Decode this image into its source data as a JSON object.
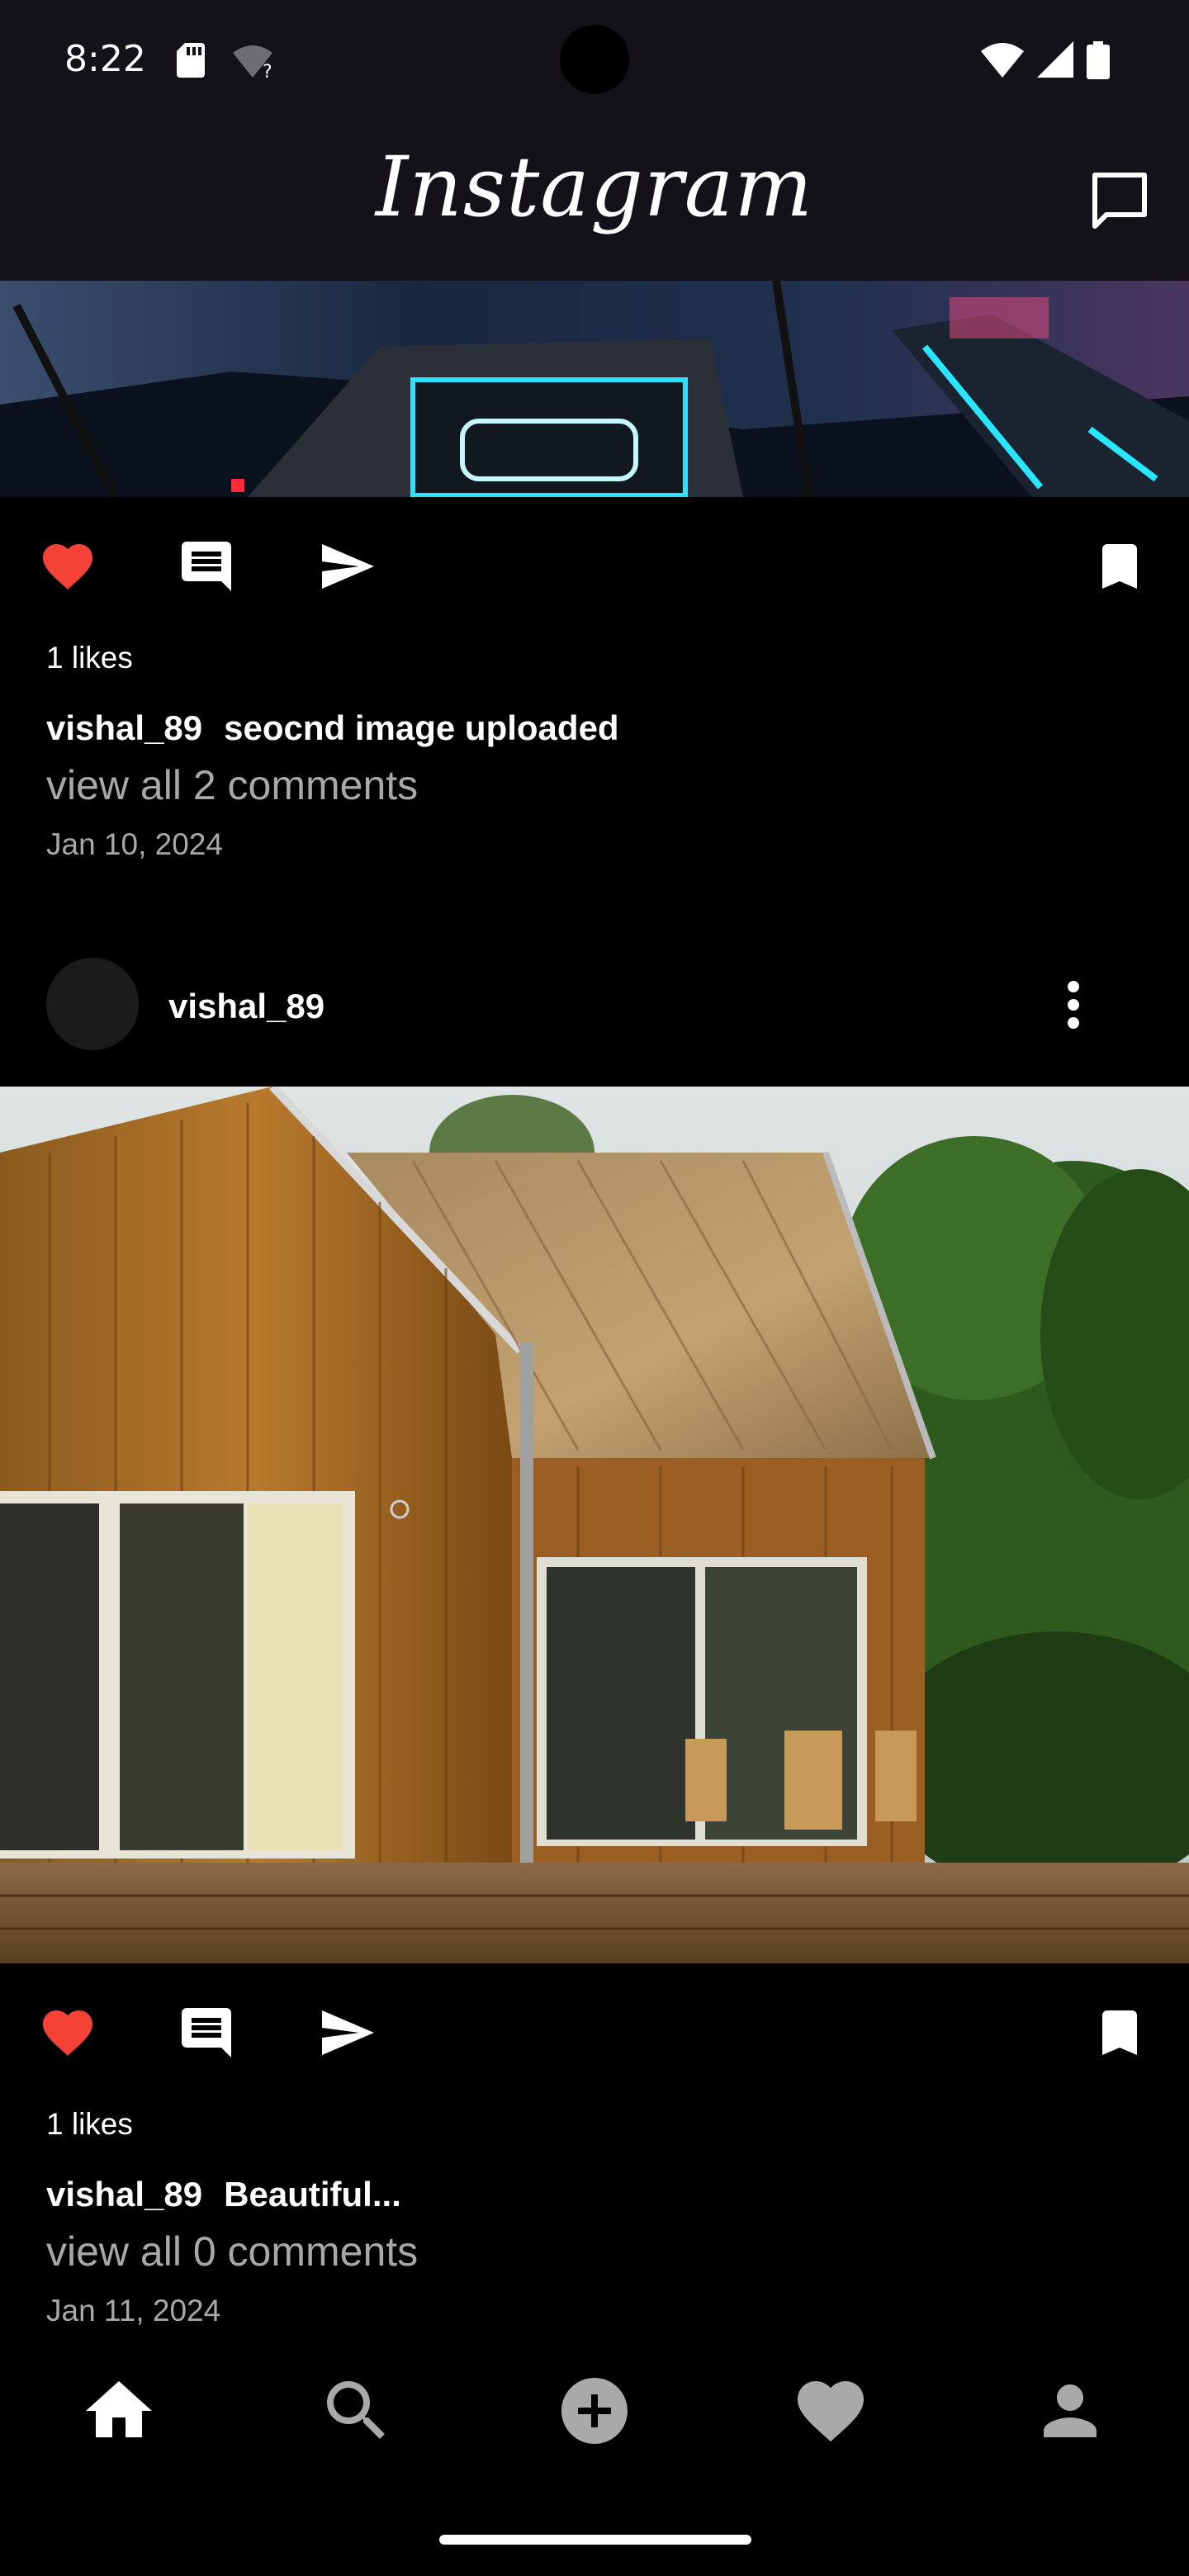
{
  "status_bar": {
    "time": "8:22",
    "icons": [
      "sd-card-icon",
      "wifi-question-icon",
      "wifi-icon",
      "signal-icon",
      "battery-icon"
    ]
  },
  "header": {
    "logo": "Instagram",
    "messages_icon": "messages-icon"
  },
  "posts": [
    {
      "liked": true,
      "likes_text": "1 likes",
      "username": "vishal_89",
      "caption": "seocnd image uploaded",
      "comments_text": "view all 2 comments",
      "date": "Jan 10, 2024",
      "image": "night-city-neon-scene"
    },
    {
      "username": "vishal_89",
      "liked": true,
      "likes_text": "1 likes",
      "caption": "Beautiful...",
      "comments_text": "view all 0 comments",
      "date": "Jan 11, 2024",
      "image": "wooden-house-with-deck"
    }
  ],
  "colors": {
    "background": "#000000",
    "header_background": "#141218",
    "like_active": "#f44336",
    "secondary_text": "#a8a8a8"
  },
  "bottom_nav": {
    "items": [
      "home-icon",
      "search-icon",
      "add-post-icon",
      "activity-heart-icon",
      "profile-icon"
    ],
    "active": "home-icon"
  }
}
